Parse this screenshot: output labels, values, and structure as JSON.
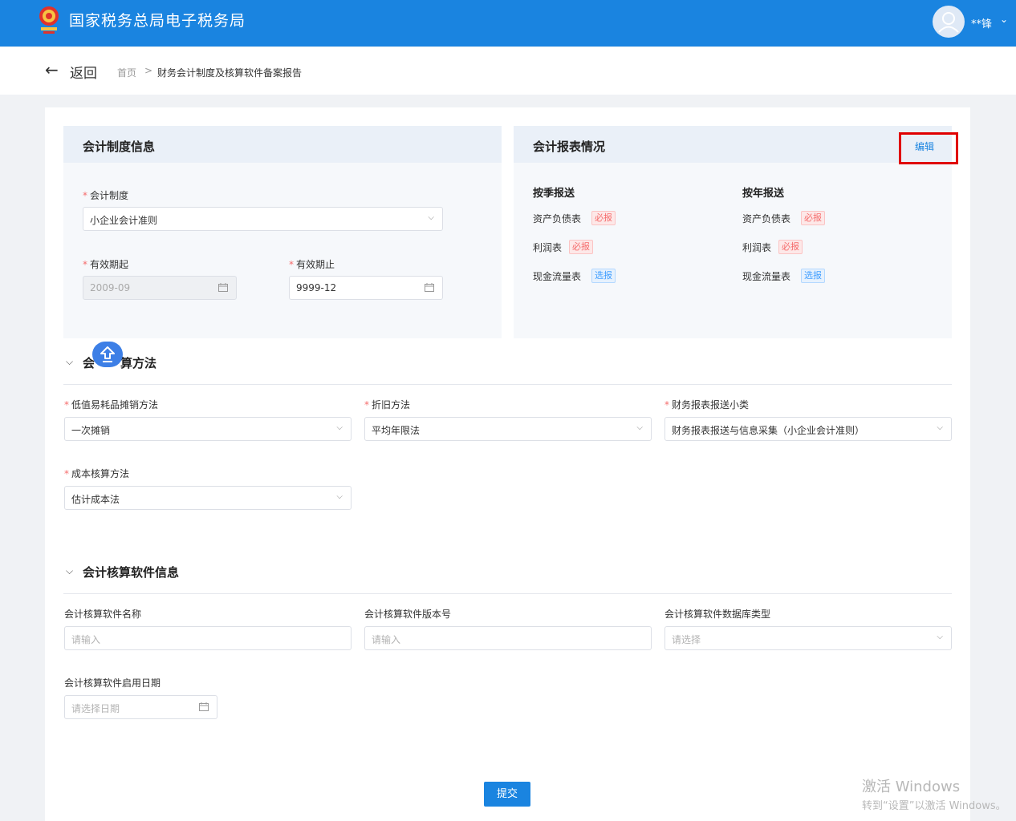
{
  "header": {
    "title": "国家税务总局电子税务局",
    "username": "**锋"
  },
  "nav": {
    "back_label": "返回",
    "breadcrumb_home": "首页",
    "breadcrumb_sep": ">",
    "breadcrumb_current": "财务会计制度及核算软件备案报告"
  },
  "accounting_system": {
    "title": "会计制度信息",
    "system_label": "会计制度",
    "system_value": "小企业会计准则",
    "start_label": "有效期起",
    "start_value": "2009-09",
    "end_label": "有效期止",
    "end_value": "9999-12"
  },
  "report": {
    "title": "会计报表情况",
    "edit_label": "编辑",
    "quarterly": {
      "heading": "按季报送",
      "items": [
        {
          "name": "资产负债表",
          "tag": "必报"
        },
        {
          "name": "利润表",
          "tag": "必报"
        },
        {
          "name": "现金流量表",
          "tag": "选报"
        }
      ]
    },
    "yearly": {
      "heading": "按年报送",
      "items": [
        {
          "name": "资产负债表",
          "tag": "必报"
        },
        {
          "name": "利润表",
          "tag": "必报"
        },
        {
          "name": "现金流量表",
          "tag": "选报"
        }
      ]
    },
    "colors": {
      "required": "#f56c6c",
      "optional": "#409eff"
    }
  },
  "methods": {
    "title_visible_start": "会",
    "title_visible_end": "算方法",
    "low_value_label": "低值易耗品摊销方法",
    "low_value_value": "一次摊销",
    "depreciation_label": "折旧方法",
    "depreciation_value": "平均年限法",
    "report_type_label": "财务报表报送小类",
    "report_type_value": "财务报表报送与信息采集（小企业会计准则）",
    "cost_label": "成本核算方法",
    "cost_value": "估计成本法"
  },
  "software": {
    "title": "会计核算软件信息",
    "name_label": "会计核算软件名称",
    "name_placeholder": "请输入",
    "version_label": "会计核算软件版本号",
    "version_placeholder": "请输入",
    "db_label": "会计核算软件数据库类型",
    "db_placeholder": "请选择",
    "date_label": "会计核算软件启用日期",
    "date_placeholder": "请选择日期"
  },
  "submit_label": "提交",
  "watermark": {
    "line1": "激活 Windows",
    "line2": "转到“设置”以激活 Windows。"
  },
  "icons": [
    "emblem-icon",
    "user-avatar-icon",
    "chevron-down-icon",
    "back-arrow-icon",
    "calendar-icon",
    "upload-icon"
  ],
  "theme": {
    "primary": "#1a84e0",
    "highlight": "#e00000"
  }
}
